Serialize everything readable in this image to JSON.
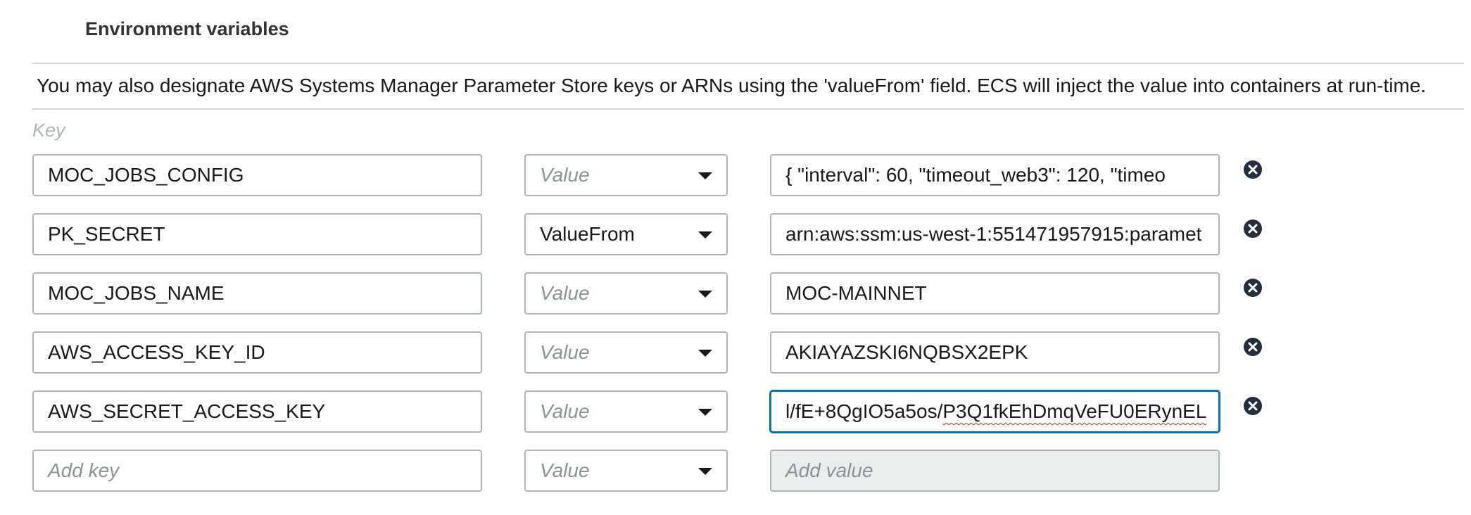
{
  "section": {
    "title": "Environment variables",
    "description": "You may also designate AWS Systems Manager Parameter Store keys or ARNs using the 'valueFrom' field. ECS will inject the value into containers at run-time.",
    "key_header": "Key"
  },
  "rows": [
    {
      "key": "MOC_JOBS_CONFIG",
      "type": "Value",
      "type_is_placeholder": true,
      "value": "{   \"interval\": 60,   \"timeout_web3\": 120,   \"timeo"
    },
    {
      "key": "PK_SECRET",
      "type": "ValueFrom",
      "type_is_placeholder": false,
      "value": "arn:aws:ssm:us-west-1:551471957915:paramet"
    },
    {
      "key": "MOC_JOBS_NAME",
      "type": "Value",
      "type_is_placeholder": true,
      "value": "MOC-MAINNET"
    },
    {
      "key": "AWS_ACCESS_KEY_ID",
      "type": "Value",
      "type_is_placeholder": true,
      "value": "AKIAYAZSKI6NQBSX2EPK"
    },
    {
      "key": "AWS_SECRET_ACCESS_KEY",
      "type": "Value",
      "type_is_placeholder": true,
      "value_prefix": "l/fE+8QgIO5a5os/",
      "value_spell": "P3Q1fkEhDmqVeFU0ERynEL"
    }
  ],
  "new_row": {
    "key_placeholder": "Add key",
    "type": "Value",
    "value_placeholder": "Add value"
  },
  "icons": {
    "remove": "remove-circle-icon",
    "dropdown": "caret-down-icon"
  },
  "colors": {
    "focus": "#0073bb",
    "border": "#aab7b8",
    "placeholder": "#879596",
    "disabled_bg": "#eaeded"
  }
}
